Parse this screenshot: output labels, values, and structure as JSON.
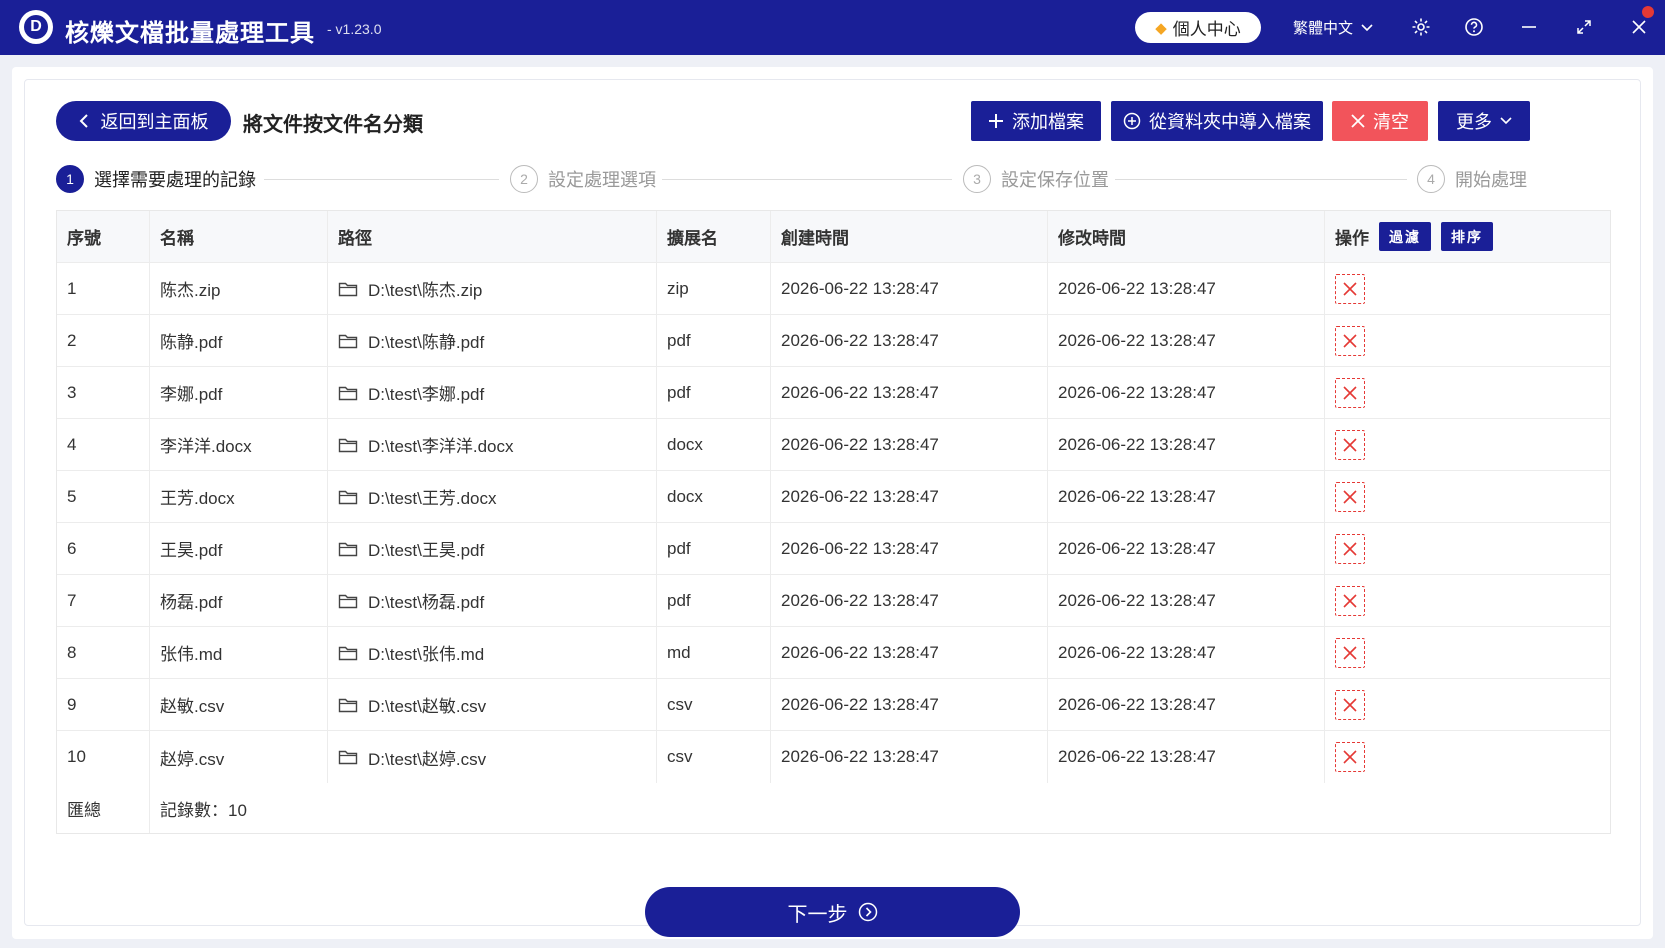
{
  "app": {
    "logo_letter": "D",
    "title": "核爍文檔批量處理工具",
    "version": "- v1.23.0",
    "personal_center": "個人中心",
    "language": "繁體中文"
  },
  "toolbar": {
    "back_label": "返回到主面板",
    "page_title": "將文件按文件名分類",
    "add_file_label": "添加檔案",
    "import_folder_label": "從資料夾中導入檔案",
    "clear_label": "清空",
    "more_label": "更多"
  },
  "steps": [
    {
      "num": "1",
      "label": "選擇需要處理的記錄",
      "active": true
    },
    {
      "num": "2",
      "label": "設定處理選項",
      "active": false
    },
    {
      "num": "3",
      "label": "設定保存位置",
      "active": false
    },
    {
      "num": "4",
      "label": "開始處理",
      "active": false
    }
  ],
  "table": {
    "headers": [
      "序號",
      "名稱",
      "路徑",
      "擴展名",
      "創建時間",
      "修改時間",
      "操作"
    ],
    "filter_label": "過濾",
    "sort_label": "排序",
    "rows": [
      {
        "no": "1",
        "name": "陈杰.zip",
        "path": "D:\\test\\陈杰.zip",
        "ext": "zip",
        "created": "2026-06-22 13:28:47",
        "modified": "2026-06-22 13:28:47"
      },
      {
        "no": "2",
        "name": "陈静.pdf",
        "path": "D:\\test\\陈静.pdf",
        "ext": "pdf",
        "created": "2026-06-22 13:28:47",
        "modified": "2026-06-22 13:28:47"
      },
      {
        "no": "3",
        "name": "李娜.pdf",
        "path": "D:\\test\\李娜.pdf",
        "ext": "pdf",
        "created": "2026-06-22 13:28:47",
        "modified": "2026-06-22 13:28:47"
      },
      {
        "no": "4",
        "name": "李洋洋.docx",
        "path": "D:\\test\\李洋洋.docx",
        "ext": "docx",
        "created": "2026-06-22 13:28:47",
        "modified": "2026-06-22 13:28:47"
      },
      {
        "no": "5",
        "name": "王芳.docx",
        "path": "D:\\test\\王芳.docx",
        "ext": "docx",
        "created": "2026-06-22 13:28:47",
        "modified": "2026-06-22 13:28:47"
      },
      {
        "no": "6",
        "name": "王昊.pdf",
        "path": "D:\\test\\王昊.pdf",
        "ext": "pdf",
        "created": "2026-06-22 13:28:47",
        "modified": "2026-06-22 13:28:47"
      },
      {
        "no": "7",
        "name": "杨磊.pdf",
        "path": "D:\\test\\杨磊.pdf",
        "ext": "pdf",
        "created": "2026-06-22 13:28:47",
        "modified": "2026-06-22 13:28:47"
      },
      {
        "no": "8",
        "name": "张伟.md",
        "path": "D:\\test\\张伟.md",
        "ext": "md",
        "created": "2026-06-22 13:28:47",
        "modified": "2026-06-22 13:28:47"
      },
      {
        "no": "9",
        "name": "赵敏.csv",
        "path": "D:\\test\\赵敏.csv",
        "ext": "csv",
        "created": "2026-06-22 13:28:47",
        "modified": "2026-06-22 13:28:47"
      },
      {
        "no": "10",
        "name": "赵婷.csv",
        "path": "D:\\test\\赵婷.csv",
        "ext": "csv",
        "created": "2026-06-22 13:28:47",
        "modified": "2026-06-22 13:28:47"
      }
    ],
    "summary_label": "匯總",
    "summary_value": "記錄數：10"
  },
  "next_label": "下一步",
  "colors": {
    "primary": "#1a1f97",
    "danger": "#f2545b",
    "delete_icon": "#e53935"
  }
}
